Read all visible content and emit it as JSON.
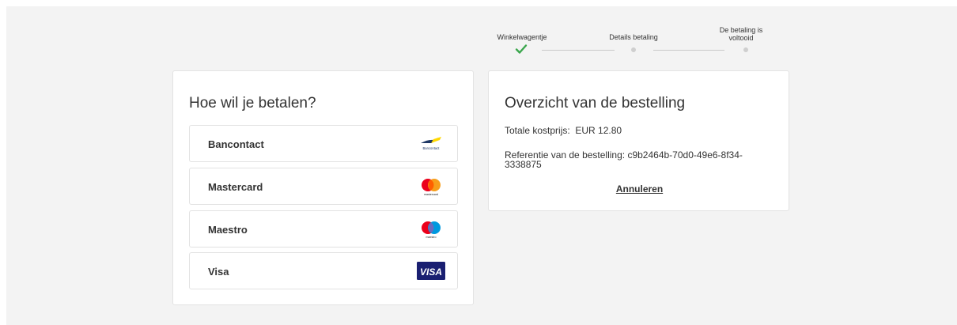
{
  "stepper": {
    "steps": [
      {
        "label": "Winkelwagentje",
        "status": "completed"
      },
      {
        "label": "Details betaling",
        "status": "pending"
      },
      {
        "label": "De betaling is voltooid",
        "status": "pending"
      }
    ]
  },
  "payment": {
    "title": "Hoe wil je betalen?",
    "methods": [
      {
        "label": "Bancontact",
        "icon": "bancontact-logo",
        "logo_text": "Bancontact"
      },
      {
        "label": "Mastercard",
        "icon": "mastercard-logo",
        "logo_text": "mastercard"
      },
      {
        "label": "Maestro",
        "icon": "maestro-logo",
        "logo_text": "maestro"
      },
      {
        "label": "Visa",
        "icon": "visa-logo",
        "logo_text": "VISA"
      }
    ]
  },
  "summary": {
    "title": "Overzicht van de bestelling",
    "total_label": "Totale kostprijs:",
    "total_value": "EUR 12.80",
    "reference_label": "Referentie van de bestelling:",
    "reference_value": "c9b2464b-70d0-49e6-8f34-3338875",
    "cancel_label": "Annuleren"
  },
  "colors": {
    "check_green": "#3aa64c",
    "background": "#f3f3f3",
    "visa_blue": "#1a1f71",
    "mastercard_red": "#eb001b",
    "mastercard_orange": "#f79e1b",
    "maestro_blue": "#0099df"
  }
}
